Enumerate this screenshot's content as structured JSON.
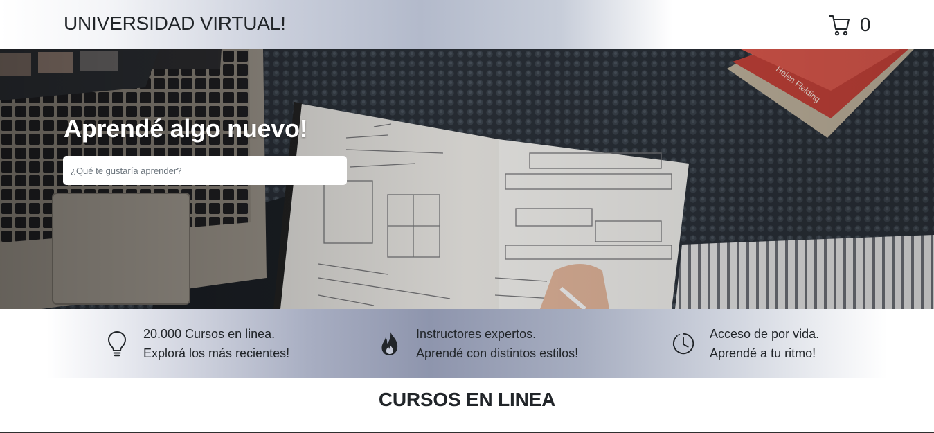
{
  "header": {
    "brand": "UNIVERSIDAD VIRTUAL!",
    "cart_icon": "shopping-cart-icon",
    "cart_count": "0"
  },
  "hero": {
    "title": "Aprendé algo nuevo!",
    "search": {
      "placeholder": "¿Qué te gustaría aprender?",
      "value": ""
    },
    "background": "laptop, notebook sketches and book on a dark bedspread"
  },
  "features": [
    {
      "icon": "lightbulb-icon",
      "line1": "20.000 Cursos en linea.",
      "line2": "Explorá los más recientes!"
    },
    {
      "icon": "fire-icon",
      "line1": "Instructores expertos.",
      "line2": "Aprendé con distintos estilos!"
    },
    {
      "icon": "clock-history-icon",
      "line1": "Acceso de por vida.",
      "line2": "Aprendé a tu ritmo!"
    }
  ],
  "section": {
    "title": "CURSOS EN LINEA"
  },
  "colors": {
    "text": "#212529",
    "hero_title": "#ffffff",
    "band_mid": "#8e95ad"
  }
}
